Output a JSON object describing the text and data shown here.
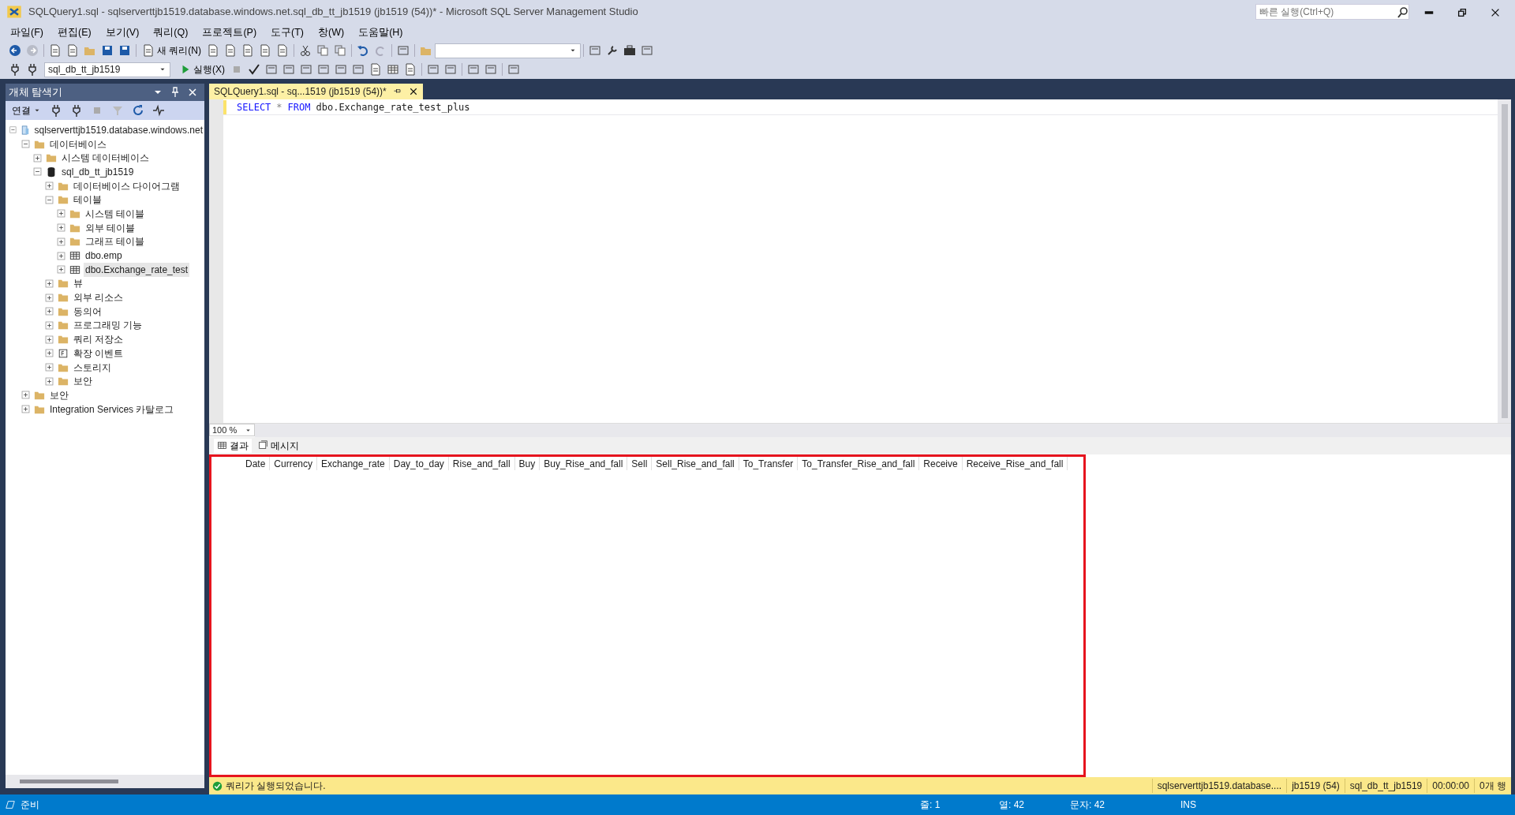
{
  "window": {
    "title": "SQLQuery1.sql - sqlserverttjb1519.database.windows.net.sql_db_tt_jb1519 (jb1519 (54))* - Microsoft SQL Server Management Studio",
    "quick_launch": {
      "placeholder": "빠른 실행(Ctrl+Q)"
    }
  },
  "menu": [
    "파일(F)",
    "편집(E)",
    "보기(V)",
    "쿼리(Q)",
    "프로젝트(P)",
    "도구(T)",
    "창(W)",
    "도움말(H)"
  ],
  "toolbar": {
    "new_query": "새 쿼리(N)",
    "database": "sql_db_tt_jb1519",
    "execute": "실행(X)"
  },
  "object_explorer": {
    "title": "개체 탐색기",
    "connect": "연결",
    "tree": [
      {
        "label": "sqlserverttjb1519.database.windows.net",
        "kind": "server",
        "expanded": true,
        "selected": false,
        "children": [
          {
            "label": "데이터베이스",
            "kind": "folder",
            "expanded": true,
            "selected": false,
            "children": [
              {
                "label": "시스템 데이터베이스",
                "kind": "folder",
                "expanded": false,
                "selected": false
              },
              {
                "label": "sql_db_tt_jb1519",
                "kind": "database",
                "expanded": true,
                "selected": false,
                "children": [
                  {
                    "label": "데이터베이스 다이어그램",
                    "kind": "folder",
                    "expanded": false,
                    "selected": false
                  },
                  {
                    "label": "테이블",
                    "kind": "folder",
                    "expanded": true,
                    "selected": false,
                    "children": [
                      {
                        "label": "시스템 테이블",
                        "kind": "folder",
                        "expanded": false,
                        "selected": false
                      },
                      {
                        "label": "외부 테이블",
                        "kind": "folder",
                        "expanded": false,
                        "selected": false
                      },
                      {
                        "label": "그래프 테이블",
                        "kind": "folder",
                        "expanded": false,
                        "selected": false
                      },
                      {
                        "label": "dbo.emp",
                        "kind": "table",
                        "expanded": false,
                        "selected": false
                      },
                      {
                        "label": "dbo.Exchange_rate_test",
                        "kind": "table",
                        "expanded": false,
                        "selected": true
                      }
                    ]
                  },
                  {
                    "label": "뷰",
                    "kind": "folder",
                    "expanded": false,
                    "selected": false
                  },
                  {
                    "label": "외부 리소스",
                    "kind": "folder",
                    "expanded": false,
                    "selected": false
                  },
                  {
                    "label": "동의어",
                    "kind": "folder",
                    "expanded": false,
                    "selected": false
                  },
                  {
                    "label": "프로그래밍 기능",
                    "kind": "folder",
                    "expanded": false,
                    "selected": false
                  },
                  {
                    "label": "쿼리 저장소",
                    "kind": "folder",
                    "expanded": false,
                    "selected": false
                  },
                  {
                    "label": "확장 이벤트",
                    "kind": "events",
                    "expanded": false,
                    "selected": false
                  },
                  {
                    "label": "스토리지",
                    "kind": "folder",
                    "expanded": false,
                    "selected": false
                  },
                  {
                    "label": "보안",
                    "kind": "folder",
                    "expanded": false,
                    "selected": false
                  }
                ]
              }
            ]
          },
          {
            "label": "보안",
            "kind": "folder",
            "expanded": false,
            "selected": false
          },
          {
            "label": "Integration Services 카탈로그",
            "kind": "folder",
            "expanded": false,
            "selected": false
          }
        ]
      }
    ]
  },
  "editor": {
    "tab": {
      "title": "SQLQuery1.sql - sq...1519 (jb1519 (54))*",
      "selected": true
    },
    "lines": [
      {
        "tokens": [
          {
            "text": "SELECT",
            "kind": "keyword"
          },
          {
            "text": "*",
            "kind": "operator"
          },
          {
            "text": "FROM",
            "kind": "keyword"
          },
          {
            "text": "dbo.Exchange_rate_test_plus",
            "kind": "identifier"
          }
        ]
      }
    ],
    "zoom": "100 %"
  },
  "results": {
    "tabs": [
      {
        "label": "결과",
        "kind": "grid",
        "selected": true
      },
      {
        "label": "메시지",
        "kind": "messages",
        "selected": false
      }
    ],
    "highlighted": true,
    "columns": [
      "Date",
      "Currency",
      "Exchange_rate",
      "Day_to_day",
      "Rise_and_fall",
      "Buy",
      "Buy_Rise_and_fall",
      "Sell",
      "Sell_Rise_and_fall",
      "To_Transfer",
      "To_Transfer_Rise_and_fall",
      "Receive",
      "Receive_Rise_and_fall"
    ]
  },
  "query_status": {
    "message": "쿼리가 실행되었습니다.",
    "server": "sqlserverttjb1519.database....",
    "user": "jb1519 (54)",
    "database": "sql_db_tt_jb1519",
    "time": "00:00:00",
    "rows": "0개 행"
  },
  "status_bar": {
    "state": "준비",
    "line": "줄: 1",
    "column": "열: 42",
    "chars": "문자: 42",
    "mode": "INS"
  }
}
